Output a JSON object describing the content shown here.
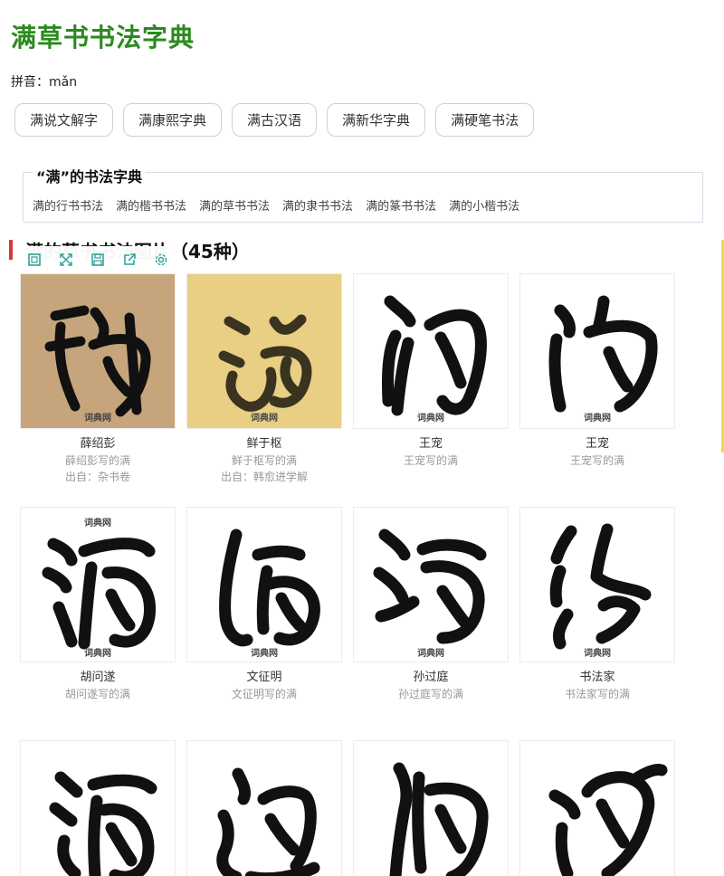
{
  "title": "满草书书法字典",
  "pinyin": "拼音：mǎn",
  "dict_buttons": [
    "满说文解字",
    "满康熙字典",
    "满古汉语",
    "满新华字典",
    "满硬笔书法"
  ],
  "calligraphy_box": {
    "title": "“满”的书法字典",
    "links": [
      "满的行书书法",
      "满的楷书书法",
      "满的草书书法",
      "满的隶书书法",
      "满的篆书书法",
      "满的小楷书法"
    ]
  },
  "section_title": "满的草书书法图片（45种）",
  "toolbar_icons": [
    "frame-icon",
    "expand-icon",
    "save-icon",
    "share-icon",
    "settings-icon"
  ],
  "watermark": "词典网",
  "items": [
    {
      "name": "薛绍彭",
      "desc": "薛绍彭写的满",
      "source": "出自：杂书卷",
      "bg": "#c7a57c"
    },
    {
      "name": "鲜于枢",
      "desc": "鲜于枢写的满",
      "source": "出自：韩愈进学解",
      "bg": "#e8cf84"
    },
    {
      "name": "王宠",
      "desc": "王宠写的满",
      "source": "",
      "bg": "#ffffff"
    },
    {
      "name": "王宠",
      "desc": "王宠写的满",
      "source": "",
      "bg": "#ffffff"
    },
    {
      "name": "胡问遂",
      "desc": "胡问遂写的满",
      "source": "",
      "bg": "#ffffff"
    },
    {
      "name": "文征明",
      "desc": "文征明写的满",
      "source": "",
      "bg": "#ffffff"
    },
    {
      "name": "孙过庭",
      "desc": "孙过庭写的满",
      "source": "",
      "bg": "#ffffff"
    },
    {
      "name": "书法家",
      "desc": "书法家写的满",
      "source": "",
      "bg": "#ffffff"
    },
    {
      "name": "",
      "desc": "",
      "source": "",
      "bg": "#ffffff"
    },
    {
      "name": "",
      "desc": "",
      "source": "",
      "bg": "#ffffff"
    },
    {
      "name": "",
      "desc": "",
      "source": "",
      "bg": "#ffffff"
    },
    {
      "name": "",
      "desc": "",
      "source": "",
      "bg": "#ffffff"
    }
  ],
  "colors": {
    "title": "#2b8a1e",
    "accent_bar": "#d23a3a",
    "ink": "#111111"
  }
}
